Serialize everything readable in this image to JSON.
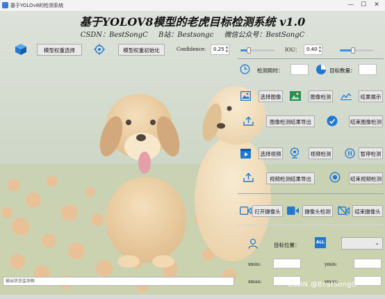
{
  "window": {
    "title": "基于YOLOv8的检测系统",
    "min": "—",
    "max": "☐",
    "close": "✕"
  },
  "header": {
    "title": "基于YOLOV8模型的老虎目标检测系统 v1.0",
    "csdn": "CSDN：BestSongC",
    "bilibili": "B站：Bestsongc",
    "wechat": "微信公众号：BestSongC"
  },
  "toolbar": {
    "select_model": "模型权重选择",
    "init_model": "模型权重初始化",
    "confidence_label": "Confidence:",
    "confidence_value": "0.25",
    "confidence_level": 0.25,
    "iou_label": "IOU：",
    "iou_value": "0.40",
    "iou_level": 0.4
  },
  "stats": {
    "time_label": "检测用时：",
    "time_value": "",
    "count_label": "目标数量：",
    "count_value": ""
  },
  "image": {
    "select": "选择图像",
    "detect": "图像检测",
    "show_result": "结果展示",
    "export": "图像检测结果导出",
    "stop": "结束图像检测"
  },
  "video": {
    "select": "选择视频",
    "detect": "视频检测",
    "pause": "暂停检测",
    "export": "视频检测结果导出",
    "stop": "结束视频检测"
  },
  "camera": {
    "open": "打开摄像头",
    "detect": "摄像头检测",
    "stop": "结束摄像头"
  },
  "target": {
    "label": "目标位置：",
    "all_icon_text": "ALL",
    "select_value": "",
    "xmin_label": "xmin:",
    "xmin_value": "",
    "ymin_label": "ymin:",
    "ymin_value": "",
    "xmax_label": "xmax:",
    "xmax_value": "",
    "ymax_label": "ymax:",
    "ymax_value": ""
  },
  "status": {
    "placeholder": "输出状态监测框"
  },
  "watermark": "CSDN @BestSongC",
  "colors": {
    "accent": "#3a8ee6",
    "icon_blue": "#1f78d1",
    "button_bg": "#e9e9e9"
  },
  "icons": {
    "model": "cube-icon",
    "init": "target-icon",
    "time": "clock-icon",
    "count": "pie-icon",
    "img_select": "image-icon",
    "img_detect": "picture-scan-icon",
    "img_show": "chart-icon",
    "img_export": "upload-icon",
    "img_stop": "check-circle-icon",
    "vid_select": "video-file-icon",
    "vid_detect": "webcam-icon",
    "vid_pause": "pause-icon",
    "vid_export": "upload-icon",
    "vid_stop": "stop-circle-icon",
    "cam_open": "camera-icon",
    "cam_detect": "camera-icon",
    "cam_stop": "camera-off-icon",
    "target": "person-icon",
    "all": "all-icon"
  }
}
